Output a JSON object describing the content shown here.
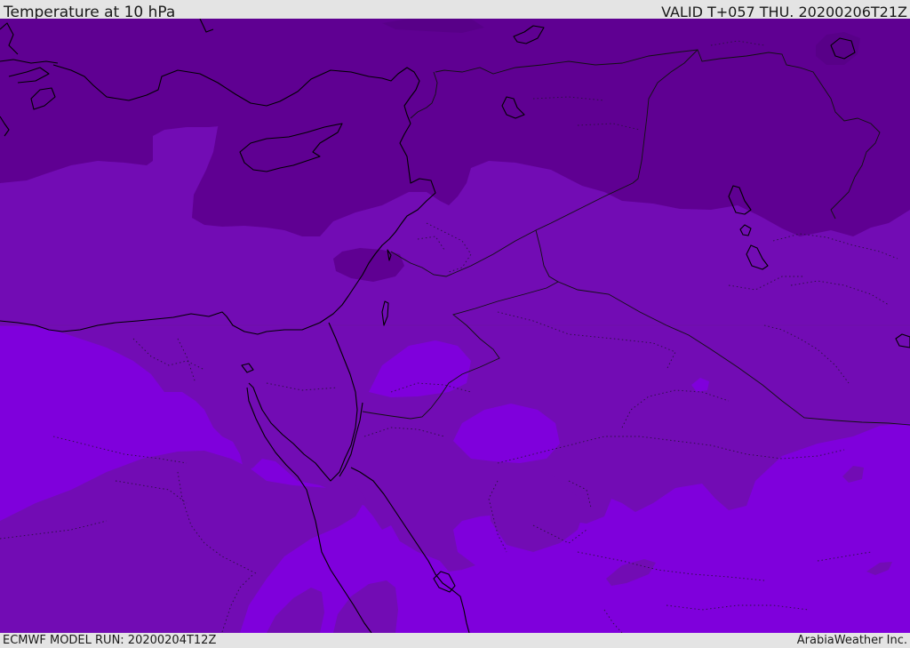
{
  "header": {
    "title": "Temperature at 10 hPa",
    "valid_time": "VALID T+057 THU. 20200206T21Z"
  },
  "footer": {
    "model_run": "ECMWF MODEL RUN: 20200204T12Z",
    "credit": "ArabiaWeather Inc."
  },
  "map": {
    "colors": {
      "band_coldest": "#5f0092",
      "band_middle": "#720cb4",
      "band_warm": "#7f00dc",
      "coastline": "#000000",
      "background": "#e4e4e4"
    }
  }
}
